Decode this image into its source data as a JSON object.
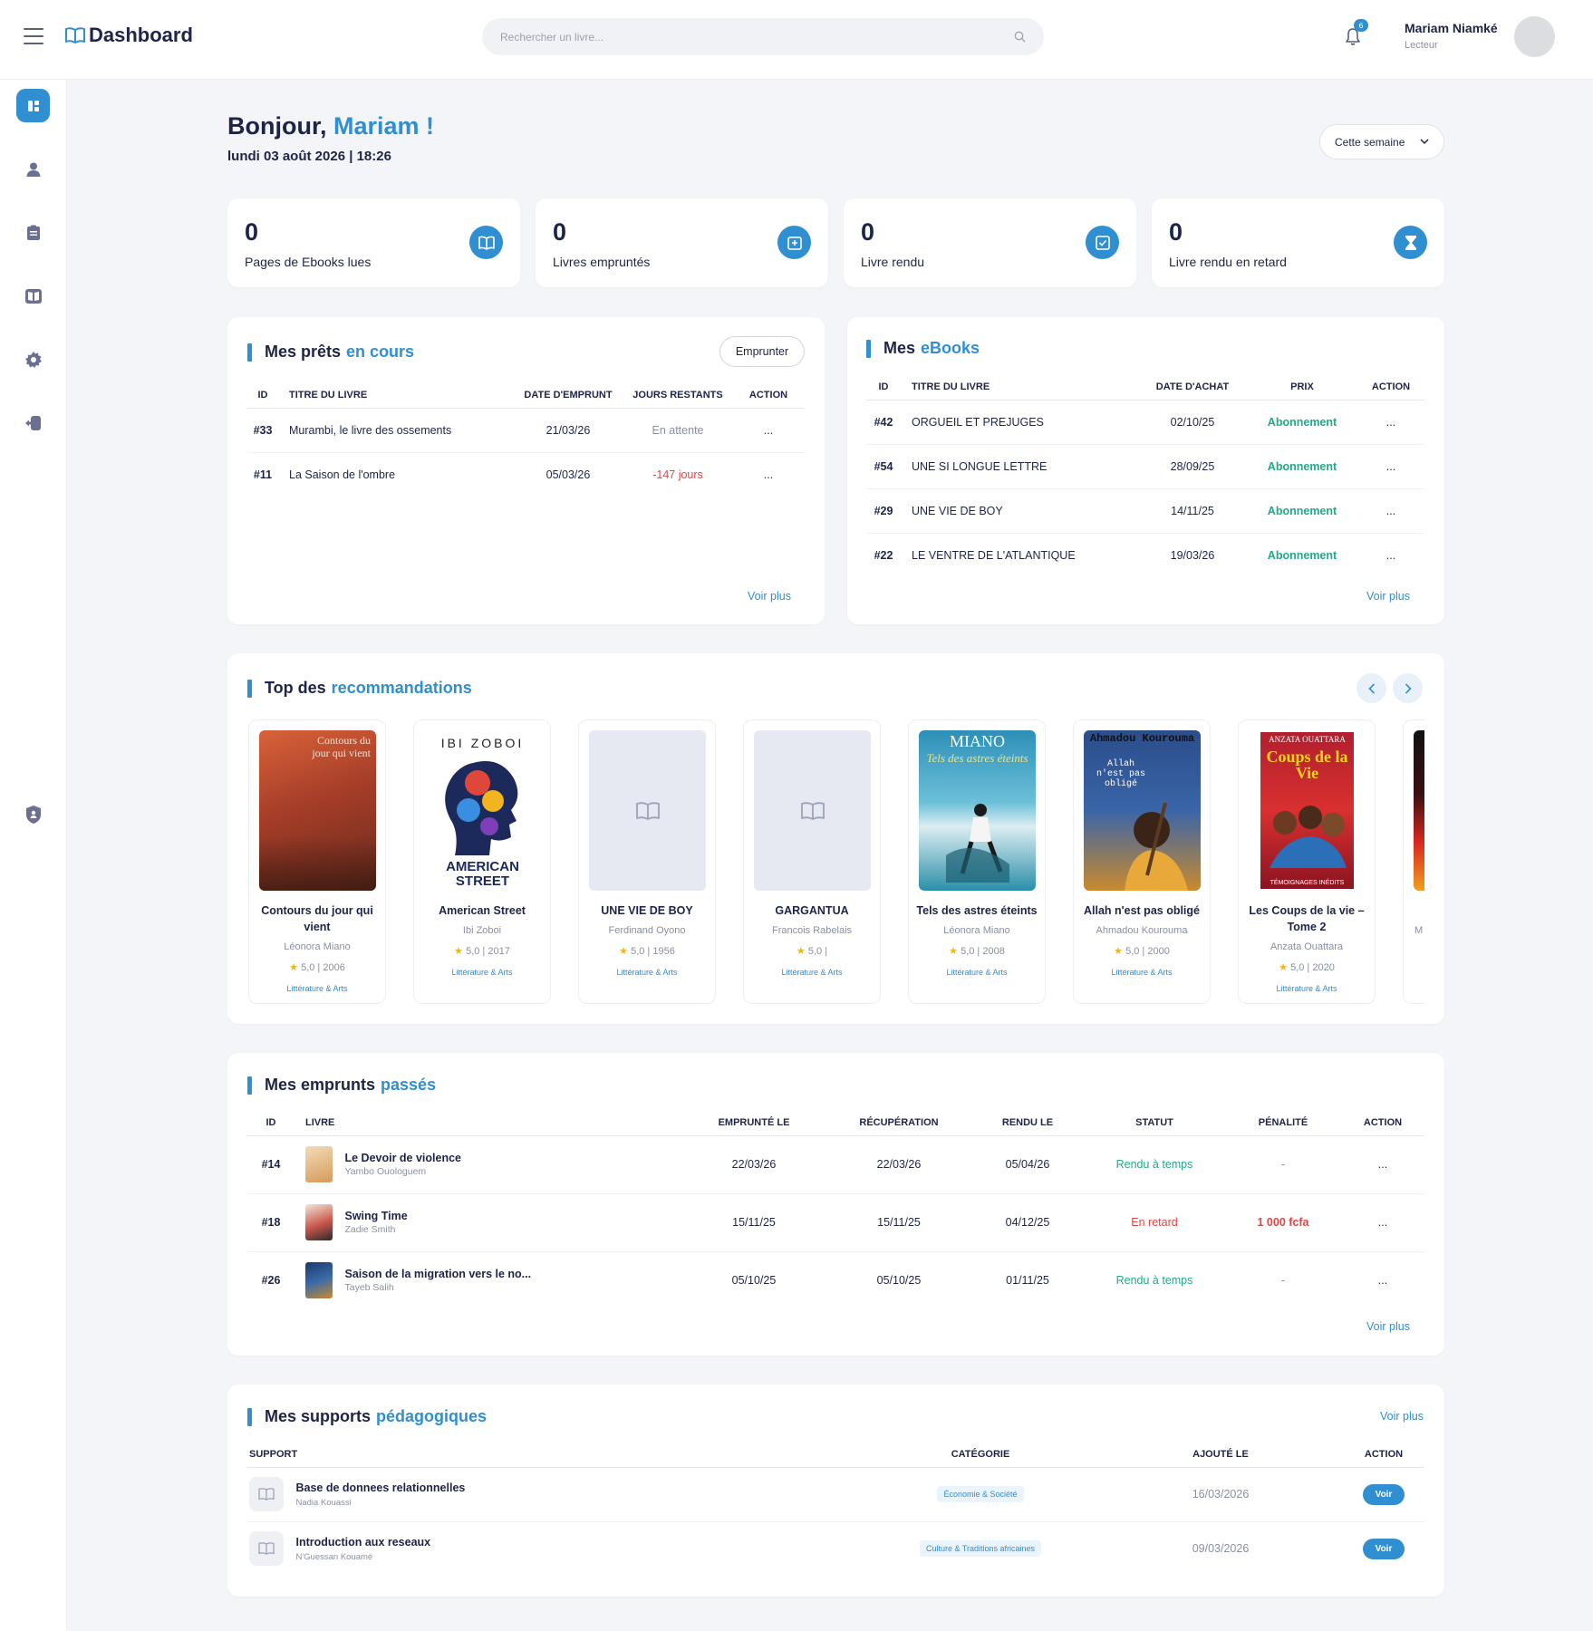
{
  "header": {
    "logo": "Dashboard",
    "search_placeholder": "Rechercher un livre...",
    "notif_count": "6",
    "user_name": "Mariam Niamké",
    "user_role": "Lecteur"
  },
  "greeting": {
    "hello": "Bonjour,",
    "name": "Mariam !",
    "date": "lundi 03 août 2026 | 18:26",
    "period": "Cette semaine"
  },
  "stats": [
    {
      "value": "0",
      "label": "Pages de Ebooks lues",
      "icon": "book-open-icon"
    },
    {
      "value": "0",
      "label": "Livres empruntés",
      "icon": "borrow-icon"
    },
    {
      "value": "0",
      "label": "Livre rendu",
      "icon": "check-icon"
    },
    {
      "value": "0",
      "label": "Livre rendu en retard",
      "icon": "hourglass-icon"
    }
  ],
  "loans": {
    "title": "Mes prêts",
    "title_hl": "en cours",
    "button": "Emprunter",
    "more": "Voir plus",
    "headers": [
      "ID",
      "TITRE DU LIVRE",
      "DATE D'EMPRUNT",
      "JOURS RESTANTS",
      "ACTION"
    ],
    "rows": [
      {
        "id": "#33",
        "title": "Murambi, le livre des ossements",
        "date": "21/03/26",
        "remaining": "En attente",
        "action": "..."
      },
      {
        "id": "#11",
        "title": "La Saison de l'ombre",
        "date": "05/03/26",
        "remaining": "-147 jours",
        "action": "..."
      }
    ]
  },
  "ebooks": {
    "title": "Mes",
    "title_hl": "eBooks",
    "more": "Voir plus",
    "headers": [
      "ID",
      "TITRE DU LIVRE",
      "DATE D'ACHAT",
      "PRIX",
      "ACTION"
    ],
    "rows": [
      {
        "id": "#42",
        "title": "ORGUEIL ET PREJUGES",
        "date": "02/10/25",
        "price": "Abonnement",
        "action": "..."
      },
      {
        "id": "#54",
        "title": "UNE SI LONGUE LETTRE",
        "date": "28/09/25",
        "price": "Abonnement",
        "action": "..."
      },
      {
        "id": "#29",
        "title": "UNE VIE DE BOY",
        "date": "14/11/25",
        "price": "Abonnement",
        "action": "..."
      },
      {
        "id": "#22",
        "title": "LE VENTRE DE L'ATLANTIQUE",
        "date": "19/03/26",
        "price": "Abonnement",
        "action": "..."
      }
    ]
  },
  "recos": {
    "title": "Top des",
    "title_hl": "recommandations",
    "books": [
      {
        "title": "Contours du jour qui vient",
        "author": "Léonora Miano",
        "rating": "5,0",
        "year": "2006",
        "category": "Littérature & Arts",
        "cover_text": "Contours du jour qui vient"
      },
      {
        "title": "American Street",
        "author": "Ibi Zoboi",
        "rating": "5,0",
        "year": "2017",
        "category": "Littérature & Arts",
        "cover_text": "IBI ZOBOI",
        "cover_text2": "AMERICAN STREET"
      },
      {
        "title": "UNE VIE DE BOY",
        "author": "Ferdinand Oyono",
        "rating": "5,0",
        "year": "1956",
        "category": "Littérature & Arts"
      },
      {
        "title": "GARGANTUA",
        "author": "Francois Rabelais",
        "rating": "5,0",
        "year": "",
        "category": "Littérature & Arts"
      },
      {
        "title": "Tels des astres éteints",
        "author": "Léonora Miano",
        "rating": "5,0",
        "year": "2008",
        "category": "Littérature & Arts",
        "cover_text": "MIANO",
        "cover_text2": "Tels des astres éteints"
      },
      {
        "title": "Allah n'est pas obligé",
        "author": "Ahmadou Kourouma",
        "rating": "5,0",
        "year": "2000",
        "category": "Littérature & Arts",
        "cover_text": "Ahmadou Kourouma",
        "cover_text2": "Allah n'est pas obligé"
      },
      {
        "title": "Les Coups de la vie – Tome 2",
        "author": "Anzata Ouattara",
        "rating": "5,0",
        "year": "2020",
        "category": "Littérature & Arts",
        "cover_text": "ANZATA OUATTARA",
        "cover_text2": "Coups de la Vie",
        "cover_text3": "TÉMOIGNAGES INÉDITS"
      },
      {
        "title": "",
        "author": "M",
        "rating": "",
        "year": "",
        "category": ""
      }
    ]
  },
  "past": {
    "title": "Mes emprunts",
    "title_hl": "passés",
    "more": "Voir plus",
    "headers": [
      "ID",
      "LIVRE",
      "EMPRUNTÉ LE",
      "RÉCUPÉRATION",
      "RENDU LE",
      "STATUT",
      "PÉNALITÉ",
      "ACTION"
    ],
    "rows": [
      {
        "id": "#14",
        "title": "Le Devoir de violence",
        "author": "Yambo Ouologuem",
        "borrowed": "22/03/26",
        "pickup": "22/03/26",
        "returned": "05/04/26",
        "status": "Rendu à temps",
        "penalty": "-",
        "action": "...",
        "thumb": "#e8c9a0"
      },
      {
        "id": "#18",
        "title": "Swing Time",
        "author": "Zadie Smith",
        "borrowed": "15/11/25",
        "pickup": "15/11/25",
        "returned": "04/12/25",
        "status": "En retard",
        "penalty": "1 000 fcfa",
        "action": "...",
        "thumb": "#c9574b"
      },
      {
        "id": "#26",
        "title": "Saison de la migration vers le no...",
        "author": "Tayeb Salih",
        "borrowed": "05/10/25",
        "pickup": "05/10/25",
        "returned": "01/11/25",
        "status": "Rendu à temps",
        "penalty": "-",
        "action": "...",
        "thumb": "#2c4a7a"
      }
    ]
  },
  "supports": {
    "title": "Mes supports",
    "title_hl": "pédagogiques",
    "more": "Voir plus",
    "headers": [
      "SUPPORT",
      "CATÉGORIE",
      "AJOUTÉ LE",
      "ACTION"
    ],
    "rows": [
      {
        "title": "Base de donnees relationnelles",
        "author": "Nadia Kouassi",
        "category": "Économie & Société",
        "added": "16/03/2026",
        "action": "Voir"
      },
      {
        "title": "Introduction aux reseaux",
        "author": "N'Guessan Kouamé",
        "category": "Culture & Traditions africaines",
        "added": "09/03/2026",
        "action": "Voir"
      }
    ]
  }
}
